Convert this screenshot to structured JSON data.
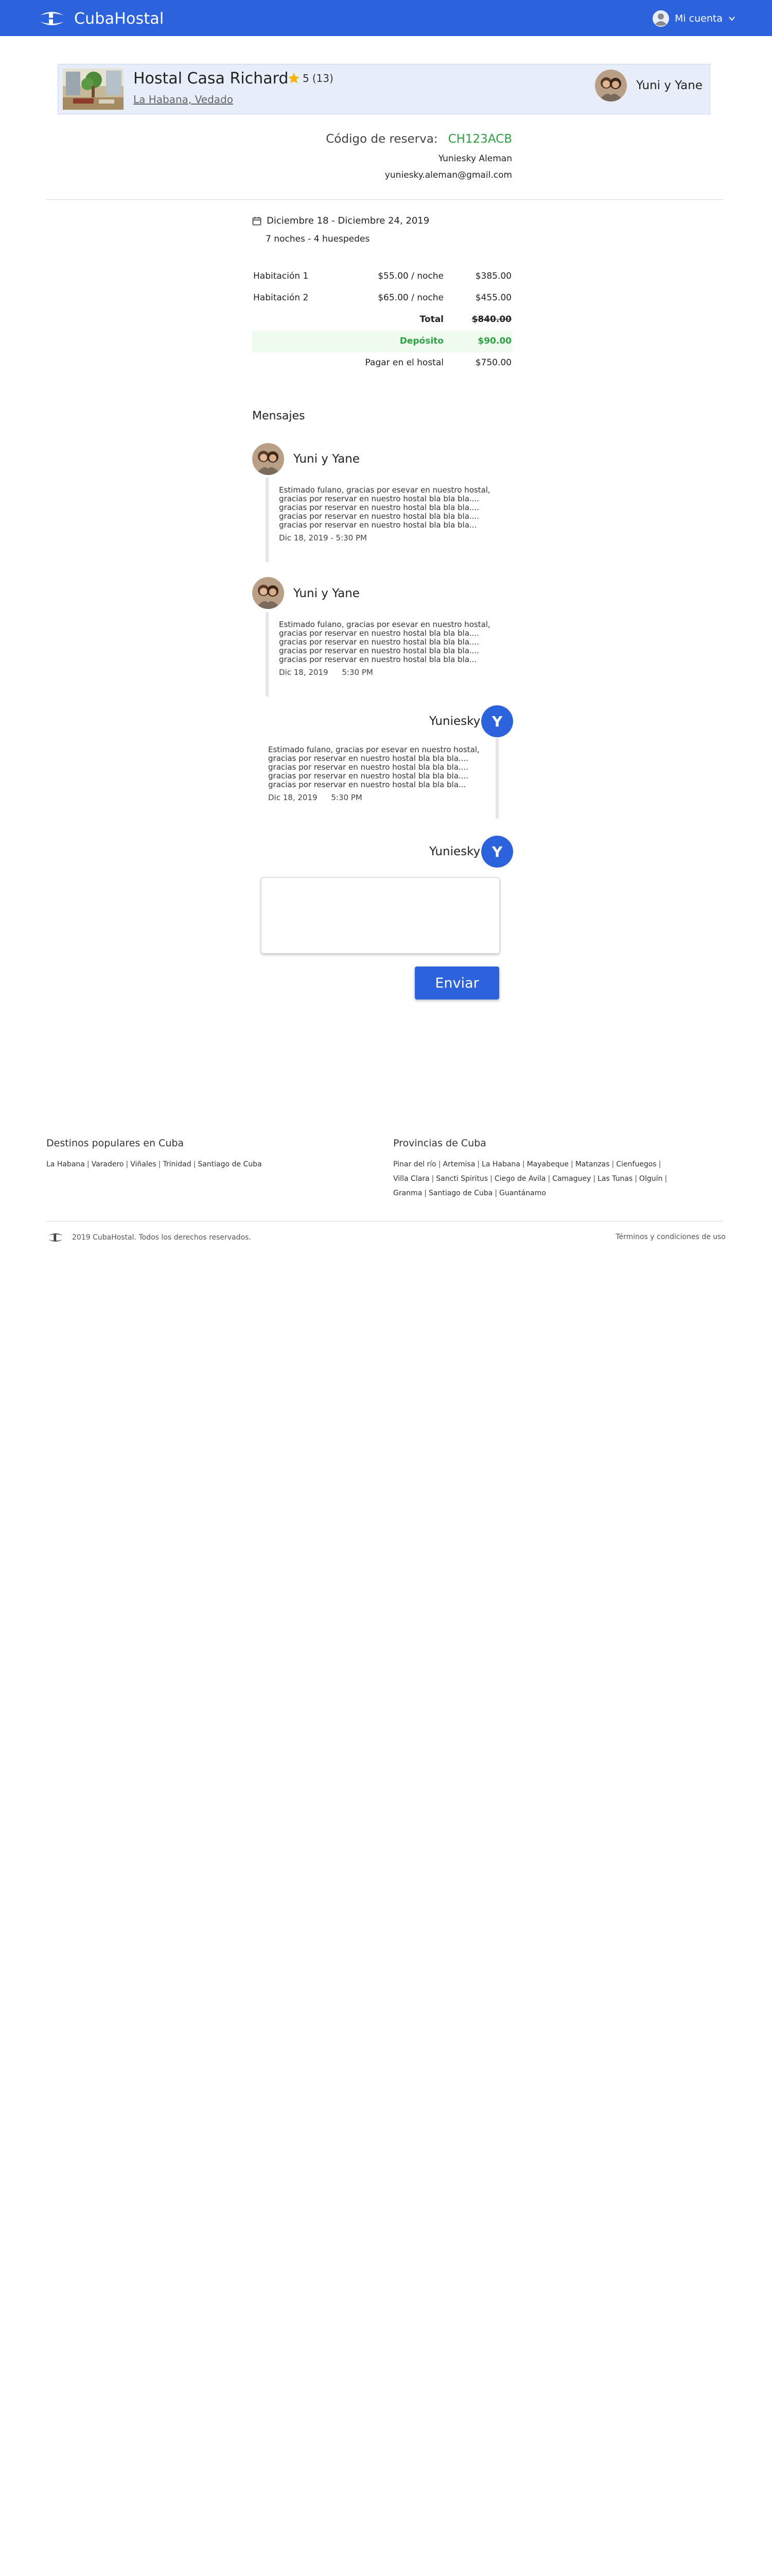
{
  "header": {
    "brand": "CubaHostal",
    "account_label": "Mi cuenta"
  },
  "listing": {
    "title": "Hostal Casa Richard",
    "rating": "5",
    "reviews": "(13)",
    "location": "La Habana, Vedado",
    "host_name": "Yuni y Yane"
  },
  "reservation": {
    "code_label": "Código de reserva:",
    "code": "CH123ACB",
    "guest_name": "Yuniesky Aleman",
    "guest_email": "yuniesky.aleman@gmail.com",
    "dates": "Diciembre 18 - Diciembre 24, 2019",
    "nights": "7 noches",
    "guests": "4 huespedes",
    "rows": [
      {
        "label": "Habitación 1",
        "rate": "$55.00 / noche",
        "amount": "$385.00"
      },
      {
        "label": "Habitación 2",
        "rate": "$65.00 / noche",
        "amount": "$455.00"
      }
    ],
    "total_label": "Total",
    "total": "$840.00",
    "deposit_label": "Depósito",
    "deposit": "$90.00",
    "pay_label": "Pagar en el hostal",
    "pay": "$750.00"
  },
  "messages": {
    "heading": "Mensajes",
    "items": [
      {
        "sender": "Yuni y Yane",
        "text": "Estimado fulano, gracias por esevar en nuestro hostal, gracias por reservar en nuestro hostal bla bla bla.... gracias por reservar en nuestro hostal bla bla bla.... gracias por reservar en nuestro hostal bla bla bla.... gracias por reservar en nuestro hostal bla bla bla...",
        "date": "Dic 18, 2019",
        "sep": "-",
        "time": "5:30 PM"
      },
      {
        "sender": "Yuni y Yane",
        "text": "Estimado fulano, gracias por esevar en nuestro hostal, gracias por reservar en nuestro hostal bla bla bla.... gracias por reservar en nuestro hostal bla bla bla.... gracias por reservar en nuestro hostal bla bla bla.... gracias por reservar en nuestro hostal bla bla bla...",
        "date": "Dic 18, 2019",
        "time": "5:30 PM"
      },
      {
        "sender": "Yuniesky",
        "initial": "Y",
        "text": "Estimado fulano, gracias por esevar en nuestro hostal, gracias por reservar en nuestro hostal bla bla bla.... gracias por reservar en nuestro hostal bla bla bla.... gracias por reservar en nuestro hostal bla bla bla.... gracias por reservar en nuestro hostal bla bla bla...",
        "date": "Dic 18, 2019",
        "time": "5:30 PM"
      }
    ],
    "reply_sender": "Yuniesky",
    "reply_initial": "Y",
    "send_label": "Enviar"
  },
  "footer": {
    "destinations_title": "Destinos populares en Cuba",
    "destinations": [
      "La Habana",
      "Varadero",
      "Viñales",
      "Trinidad",
      "Santiago de Cuba"
    ],
    "provinces_title": "Provincias de Cuba",
    "provinces_line1": [
      "Pinar del río",
      "Artemisa",
      "La Habana",
      "Mayabeque",
      "Matanzas",
      "Cienfuegos"
    ],
    "provinces_line2": [
      "Villa Clara",
      "Sancti Spiritus",
      "Ciego de Avila",
      "Camaguey",
      "Las Tunas",
      "Olguín"
    ],
    "provinces_line3": [
      "Granma",
      "Santiago de Cuba",
      "Guantánamo"
    ],
    "copyright": "2019 CubaHostal. Todos los derechos reservados.",
    "terms": "Términos y condiciones de uso"
  },
  "colors": {
    "brand": "#2c63dc",
    "success": "#2ea043",
    "listing_bg": "#e7eef9"
  }
}
